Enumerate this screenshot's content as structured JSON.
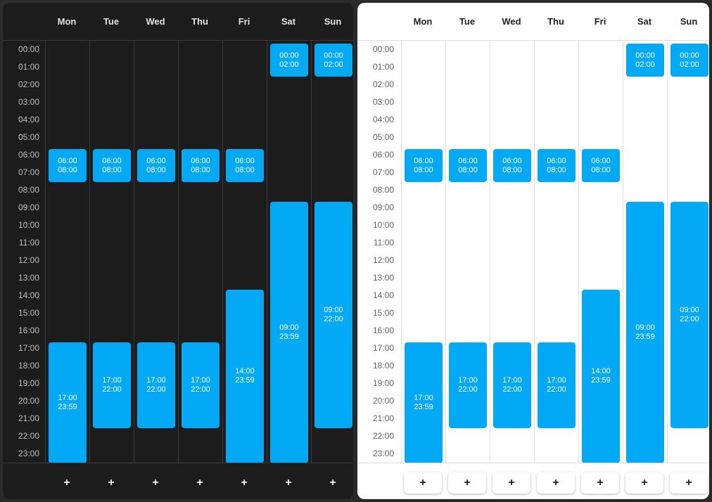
{
  "accent_color": "#03a9f4",
  "days": [
    "Mon",
    "Tue",
    "Wed",
    "Thu",
    "Fri",
    "Sat",
    "Sun"
  ],
  "hours": [
    "00:00",
    "01:00",
    "02:00",
    "03:00",
    "04:00",
    "05:00",
    "06:00",
    "07:00",
    "08:00",
    "09:00",
    "10:00",
    "11:00",
    "12:00",
    "13:00",
    "14:00",
    "15:00",
    "16:00",
    "17:00",
    "18:00",
    "19:00",
    "20:00",
    "21:00",
    "22:00",
    "23:00"
  ],
  "add_label": "+",
  "add_icon": "plus-icon",
  "schedule": [
    [
      {
        "start": "06:00",
        "end": "08:00"
      },
      {
        "start": "17:00",
        "end": "23:59"
      }
    ],
    [
      {
        "start": "06:00",
        "end": "08:00"
      },
      {
        "start": "17:00",
        "end": "22:00"
      }
    ],
    [
      {
        "start": "06:00",
        "end": "08:00"
      },
      {
        "start": "17:00",
        "end": "22:00"
      }
    ],
    [
      {
        "start": "06:00",
        "end": "08:00"
      },
      {
        "start": "17:00",
        "end": "22:00"
      }
    ],
    [
      {
        "start": "06:00",
        "end": "08:00"
      },
      {
        "start": "14:00",
        "end": "23:59"
      }
    ],
    [
      {
        "start": "00:00",
        "end": "02:00"
      },
      {
        "start": "09:00",
        "end": "23:59"
      }
    ],
    [
      {
        "start": "00:00",
        "end": "02:00"
      },
      {
        "start": "09:00",
        "end": "22:00"
      }
    ]
  ],
  "themes": [
    "dark",
    "light"
  ]
}
